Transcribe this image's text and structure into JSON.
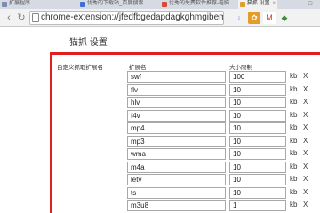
{
  "tabs": [
    {
      "label": "扩展程序",
      "favicon_color": "#7a8fb0"
    },
    {
      "label": "优秀的下载站_百度搜索",
      "favicon_color": "#3b6fd6"
    },
    {
      "label": "优秀的免费软件推荐-电脑",
      "favicon_color": "#d84a3a"
    },
    {
      "label": "猫抓 设置",
      "favicon_color": "#e0a030",
      "active": true
    }
  ],
  "window_controls": {
    "minimize": "–",
    "maximize": "□"
  },
  "toolbar": {
    "url": "chrome-extension://jfedfbgedapdagkghmgibem",
    "star": "☆",
    "extensions": [
      {
        "name": "download-icon",
        "glyph": "↓",
        "color": "#2b6bd6",
        "bg": "transparent"
      },
      {
        "name": "cat-icon",
        "glyph": "✿",
        "color": "#ffffff",
        "bg": "#e39b2a"
      },
      {
        "name": "gmail-icon",
        "glyph": "M",
        "color": "#d23b2f",
        "bg": "#ffffff"
      },
      {
        "name": "extension-icon",
        "glyph": "◆",
        "color": "#3a8f3a",
        "bg": "transparent"
      }
    ]
  },
  "page": {
    "title": "猫抓 设置",
    "section_label": "自定义抓取扩展名",
    "col_ext_header": "扩展名",
    "col_size_header": "大小限制",
    "unit": "kb",
    "delete_label": "X",
    "rows": [
      {
        "ext": "swf",
        "size": "100"
      },
      {
        "ext": "flv",
        "size": "10"
      },
      {
        "ext": "hlv",
        "size": "10"
      },
      {
        "ext": "f4v",
        "size": "10"
      },
      {
        "ext": "mp4",
        "size": "10"
      },
      {
        "ext": "mp3",
        "size": "10"
      },
      {
        "ext": "wma",
        "size": "10"
      },
      {
        "ext": "m4a",
        "size": "10"
      },
      {
        "ext": "letv",
        "size": "10"
      },
      {
        "ext": "ts",
        "size": "10"
      },
      {
        "ext": "m3u8",
        "size": "1"
      }
    ]
  }
}
